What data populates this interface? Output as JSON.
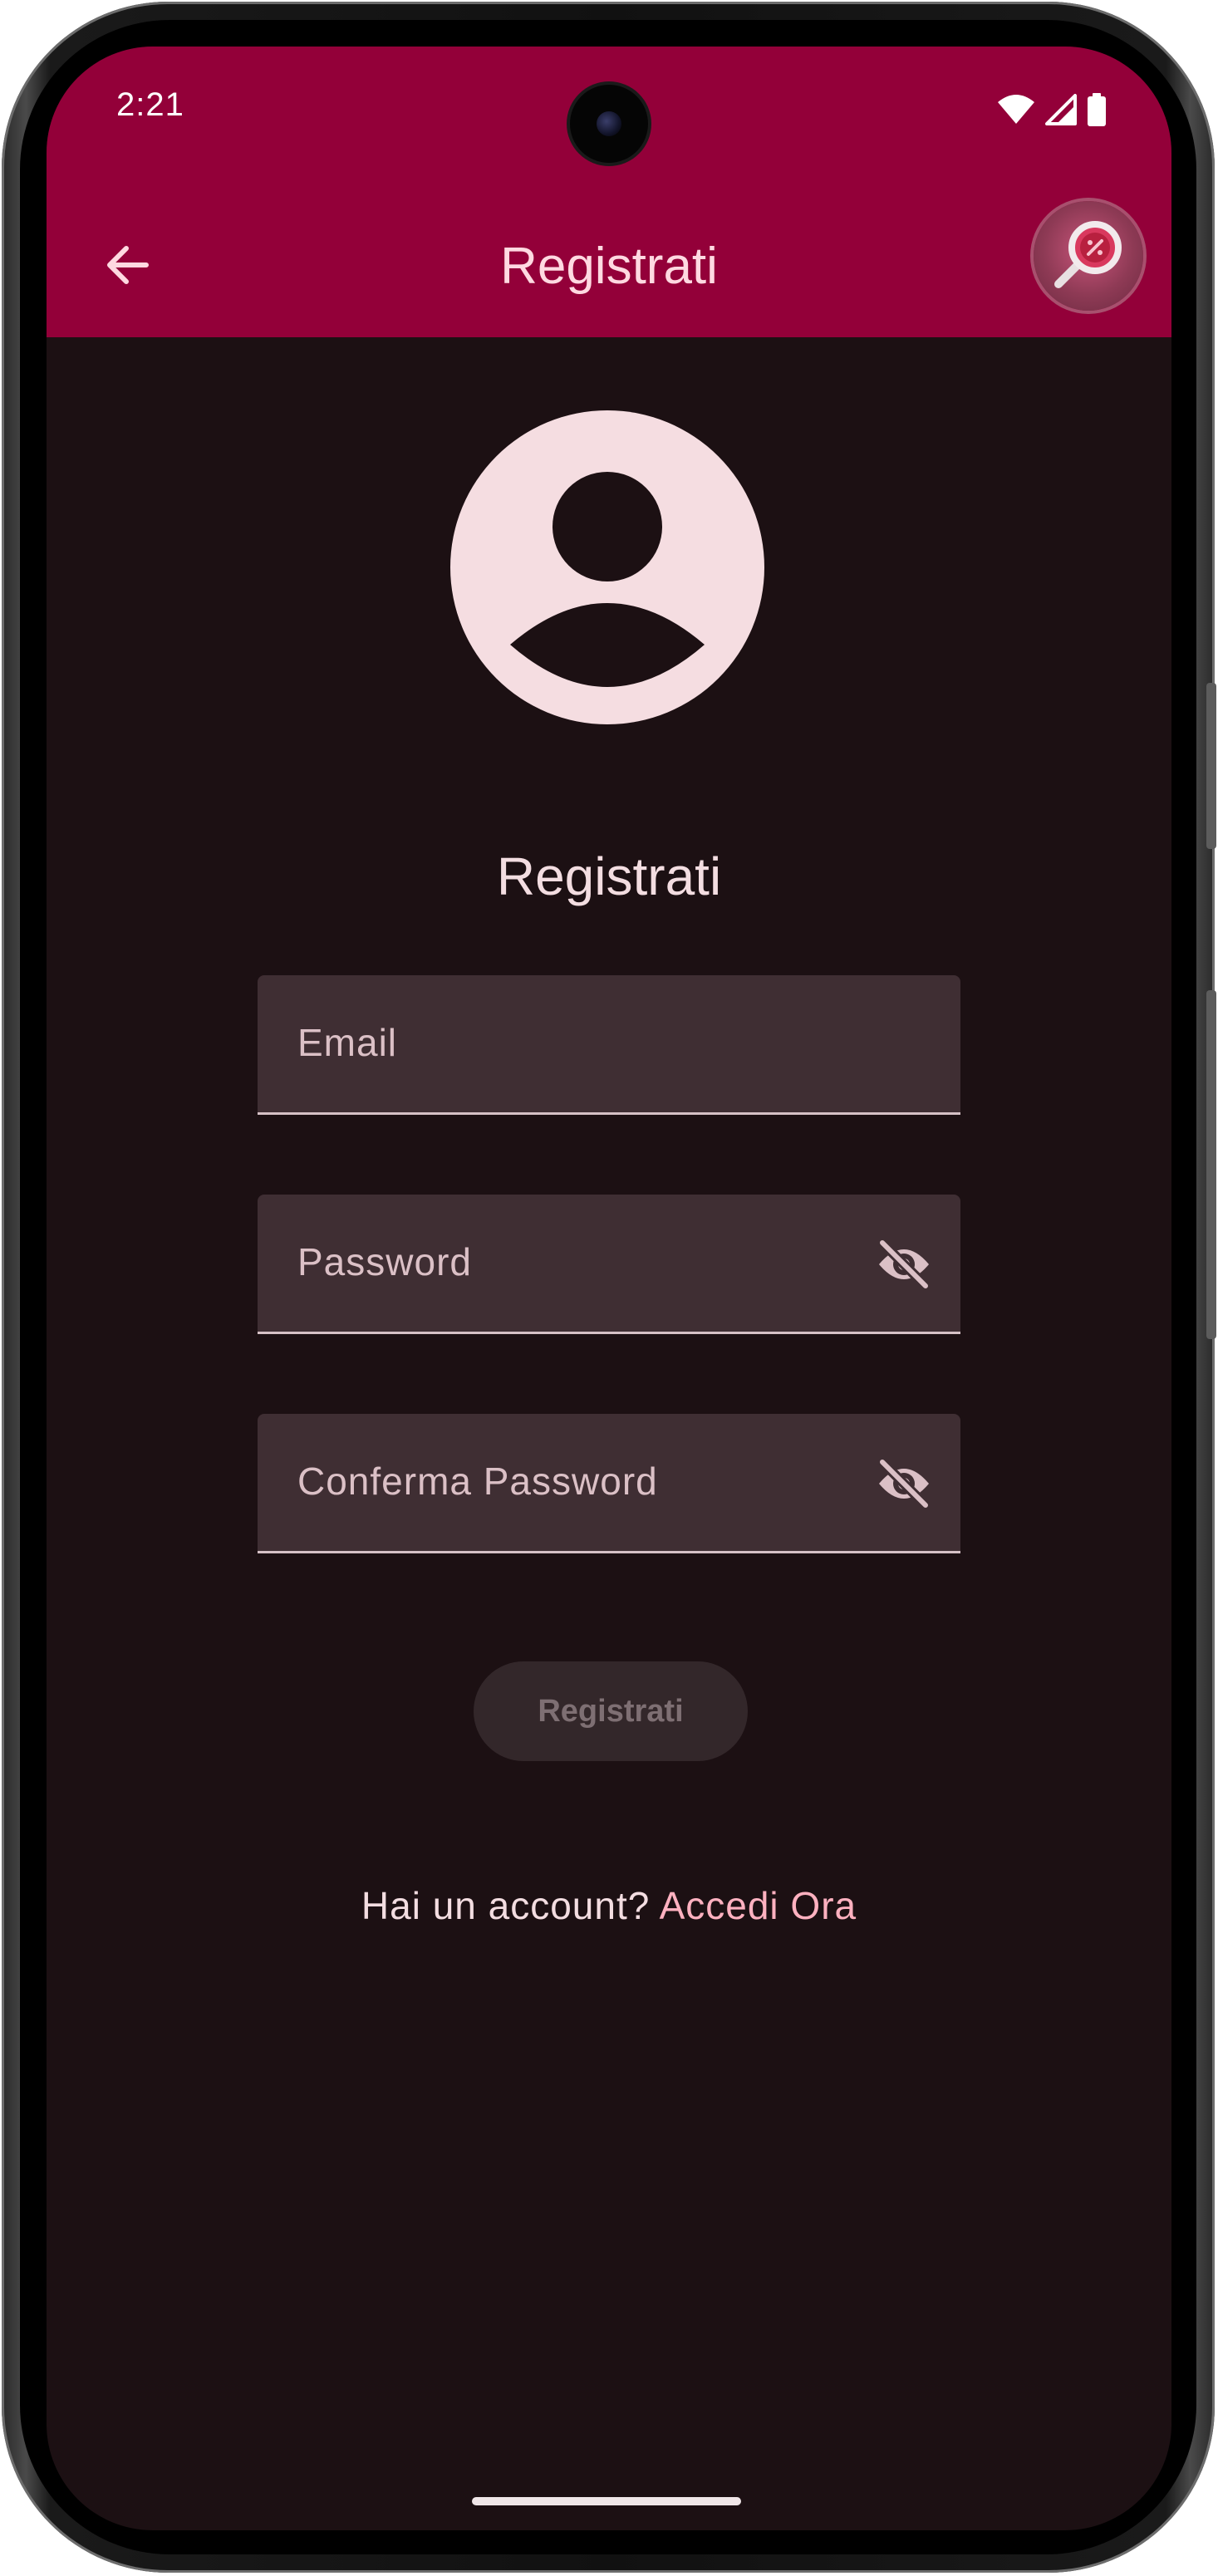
{
  "status_bar": {
    "time": "2:21",
    "icons": [
      "wifi-icon",
      "cellular-signal-icon",
      "battery-icon"
    ]
  },
  "app_bar": {
    "title": "Registrati",
    "back_icon": "arrow-back-icon",
    "avatar_icon": "magnifier-avatar-icon",
    "background_color": "#930039"
  },
  "form": {
    "avatar_icon": "account-circle-icon",
    "title": "Registrati",
    "fields": [
      {
        "label": "Email",
        "trailing_icon": null
      },
      {
        "label": "Password",
        "trailing_icon": "visibility-off-icon"
      },
      {
        "label": "Conferma Password",
        "trailing_icon": "visibility-off-icon"
      }
    ],
    "submit_label": "Registrati",
    "submit_enabled": false,
    "login_prompt": "Hai un account?",
    "login_link": "Accedi Ora"
  },
  "colors": {
    "background": "#1c1013",
    "field_fill": "#3f2e33",
    "link": "#ffb1c0",
    "text": "#f3dde1"
  }
}
